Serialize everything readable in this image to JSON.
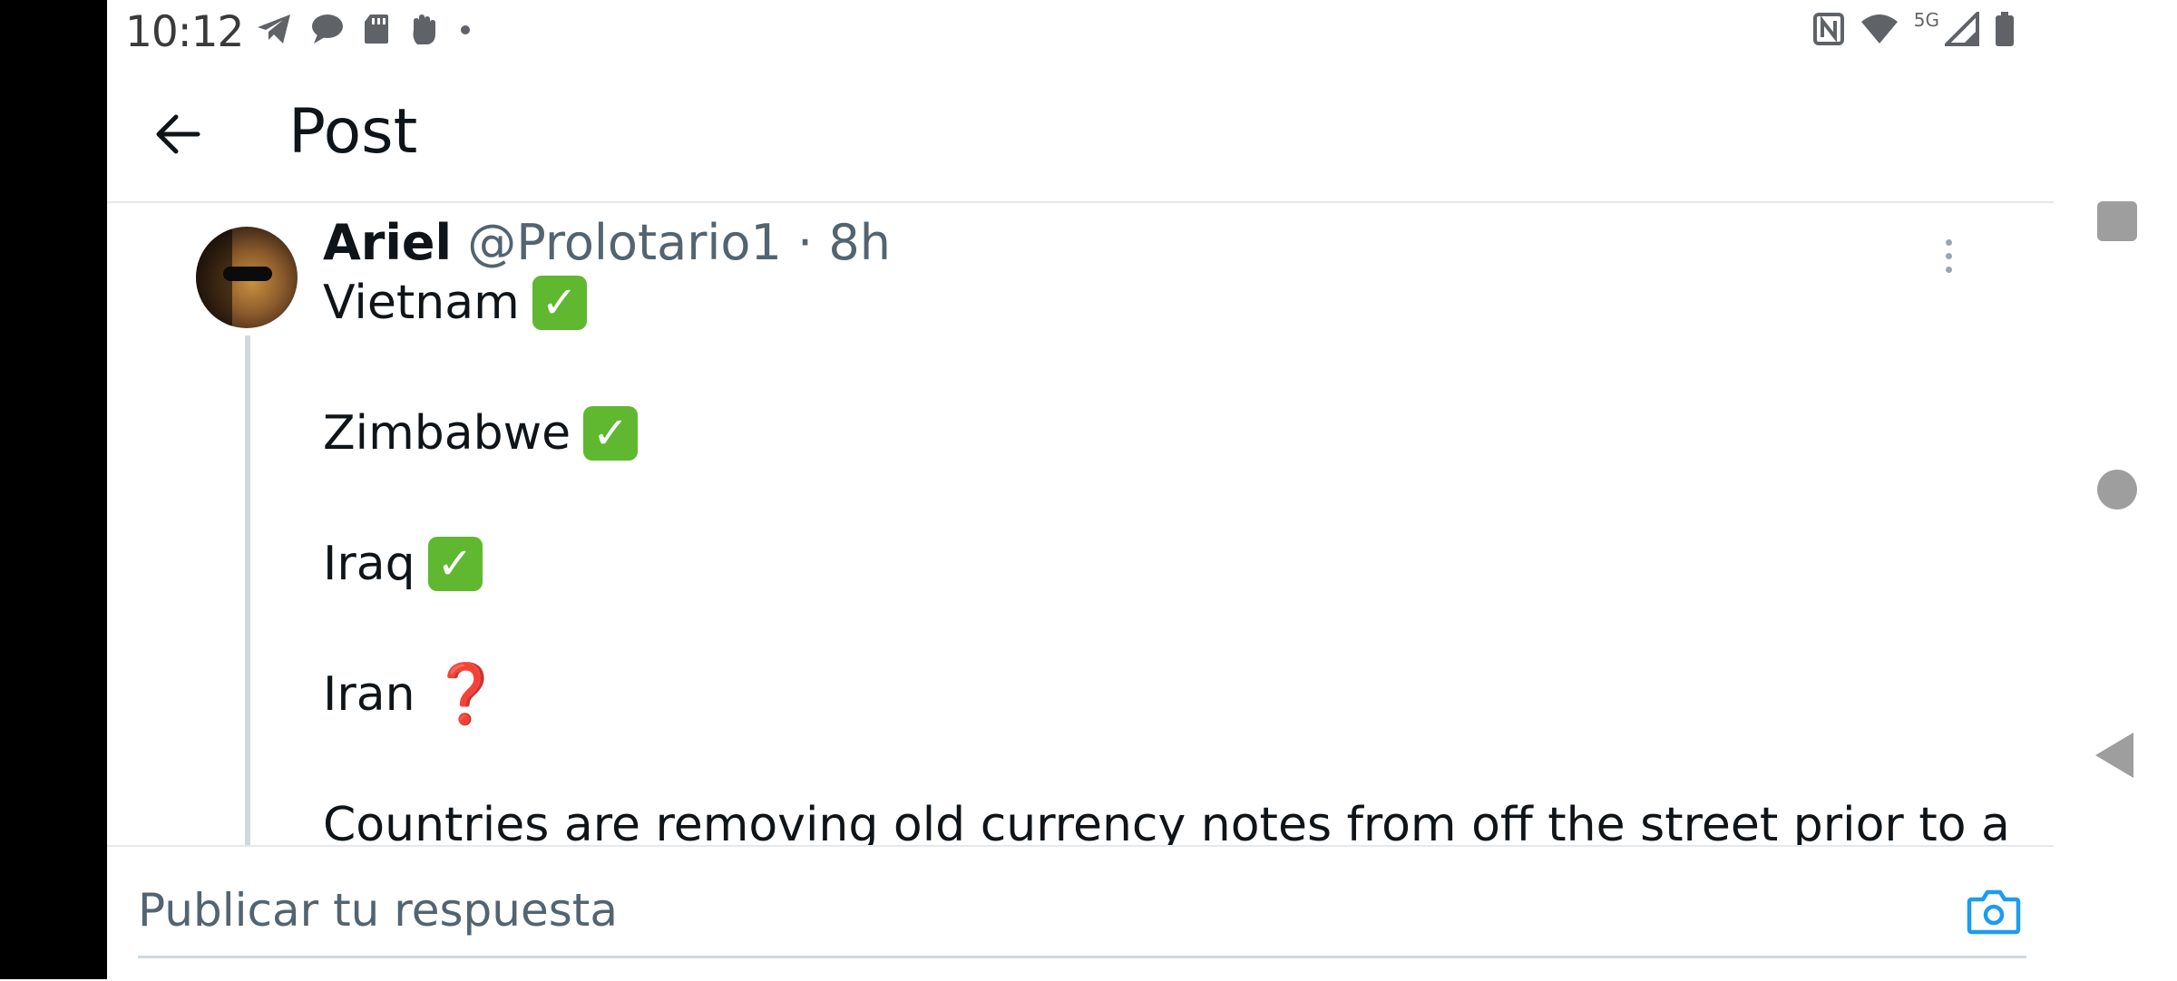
{
  "status_bar": {
    "time": "10:12",
    "network_label": "5G",
    "icons": [
      "telegram-icon",
      "chat-bubble-icon",
      "sd-card-icon",
      "hand-gesture-icon",
      "dot-icon",
      "nfc-icon",
      "wifi-icon",
      "signal-icon",
      "battery-icon"
    ]
  },
  "header": {
    "title": "Post",
    "back_icon": "arrow-left-icon"
  },
  "post": {
    "author_name": "Ariel",
    "author_handle": "@Prolotario1",
    "separator": "·",
    "time_ago": "8h",
    "lines": [
      {
        "text": "Vietnam",
        "emoji": "✓"
      },
      {
        "text": "Zimbabwe",
        "emoji": "✓"
      },
      {
        "text": "Iraq",
        "emoji": "✓"
      },
      {
        "text": "Iran",
        "emoji": "❓"
      },
      {
        "text": "Countries are removing old currency notes from off the street prior to a"
      }
    ],
    "accent_check": "#5fb830",
    "accent_question": "#e0231a"
  },
  "reply": {
    "placeholder": "Publicar tu respuesta",
    "camera_icon": "camera-icon",
    "accent": "#1d9bf0"
  },
  "navigation_bar": {
    "icons": [
      "recents-icon",
      "home-icon",
      "back-icon"
    ]
  }
}
